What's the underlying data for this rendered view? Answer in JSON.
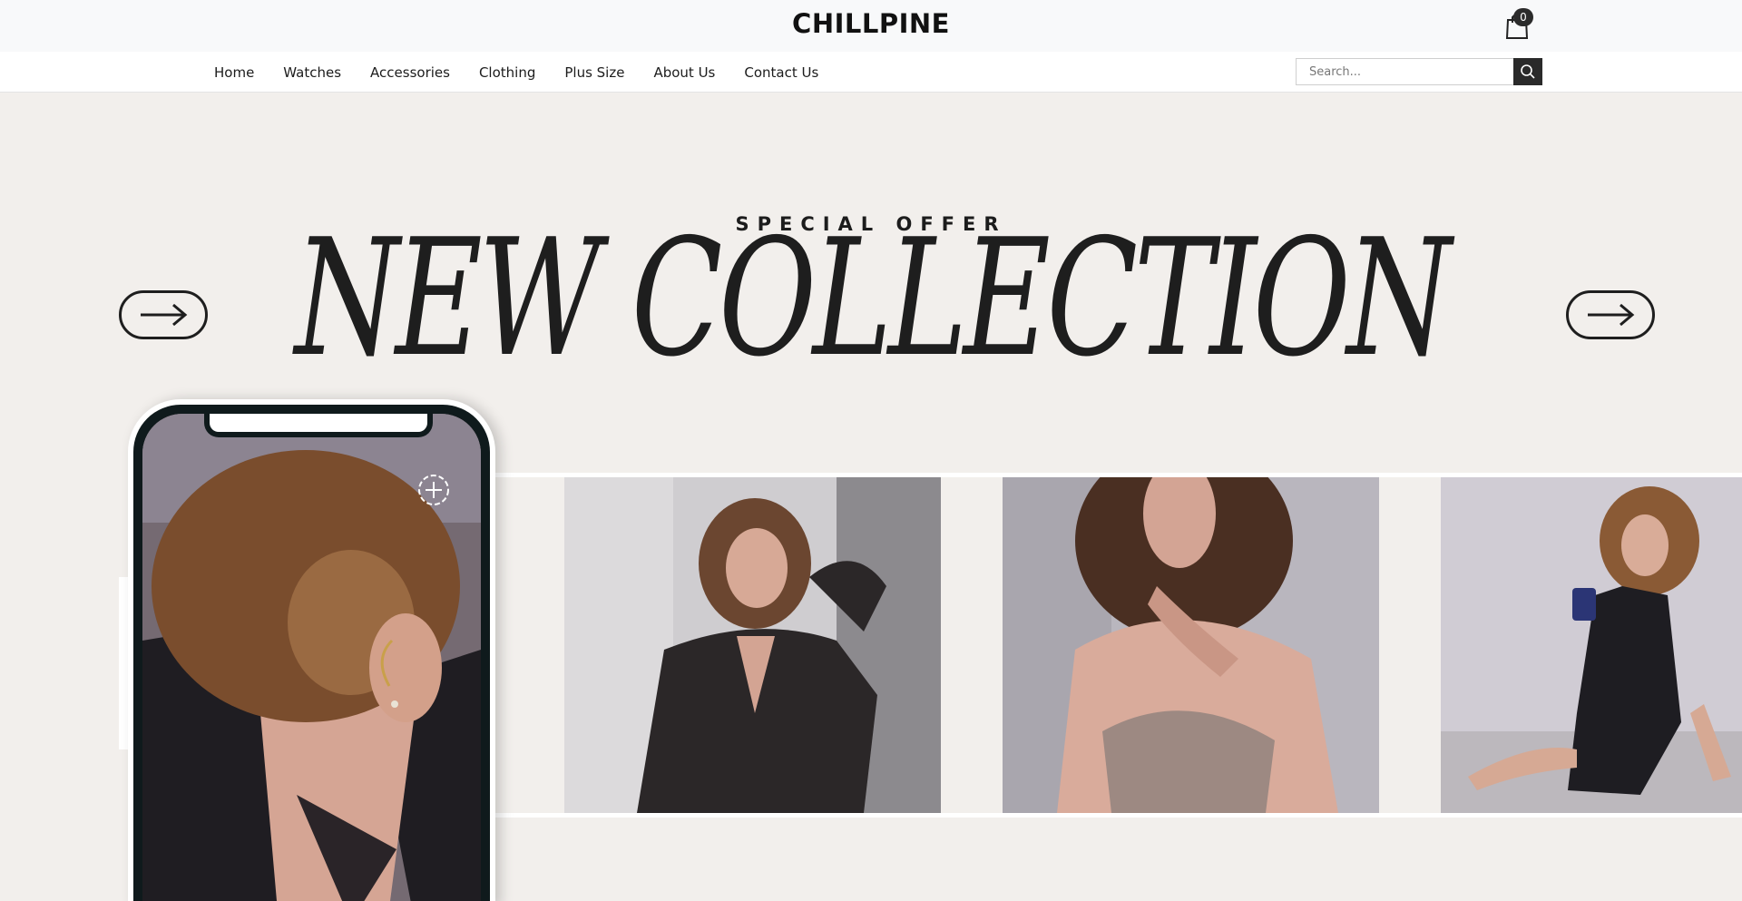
{
  "header": {
    "logo": "CHILLPINE",
    "cart_count": "0",
    "cart_icon": "shopping-bag-icon"
  },
  "nav": {
    "items": [
      {
        "label": "Home"
      },
      {
        "label": "Watches"
      },
      {
        "label": "Accessories"
      },
      {
        "label": "Clothing"
      },
      {
        "label": "Plus Size"
      },
      {
        "label": "About Us"
      },
      {
        "label": "Contact Us"
      }
    ]
  },
  "search": {
    "placeholder": "Search...",
    "icon": "search-icon"
  },
  "hero": {
    "kicker": "SPECIAL OFFER",
    "headline": "NEW COLLECTION",
    "prev_icon": "arrow-right-icon",
    "next_icon": "arrow-right-icon"
  },
  "phone": {
    "hotspot_icon": "plus-circle-icon"
  },
  "colors": {
    "background": "#f2efec",
    "topbar": "#f8f9fa",
    "text": "#1c1c1c",
    "search_button": "#2a2a2a"
  }
}
